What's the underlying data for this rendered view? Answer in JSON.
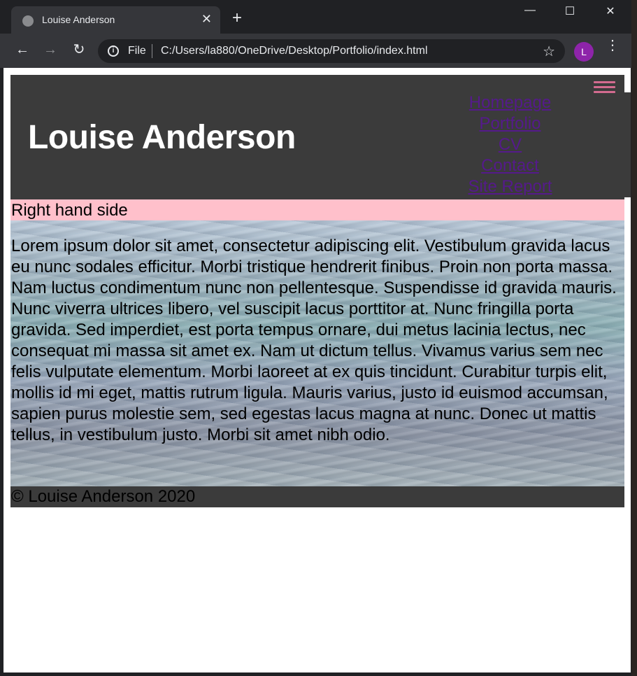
{
  "browser": {
    "tab_title": "Louise Anderson",
    "tab_close": "✕",
    "new_tab": "+",
    "minimize": "—",
    "maximize": "☐",
    "close": "✕",
    "back": "←",
    "forward": "→",
    "reload": "↻",
    "info": "i",
    "scheme": "File",
    "url": "C:/Users/la880/OneDrive/Desktop/Portfolio/index.html",
    "star": "☆",
    "profile_initial": "L",
    "menu": "⋮"
  },
  "page": {
    "site_title": "Louise Anderson",
    "nav": [
      "Homepage",
      "Portfolio",
      "CV",
      "Contact",
      "Site Report"
    ],
    "banner": "Right hand side",
    "body_text": "Lorem ipsum dolor sit amet, consectetur adipiscing elit. Vestibulum gravida lacus eu nunc sodales efficitur. Morbi tristique hendrerit finibus. Proin non porta massa. Nam luctus condimentum nunc non pellentesque. Suspendisse id gravida mauris. Nunc viverra ultrices libero, vel suscipit lacus porttitor at. Nunc fringilla porta gravida. Sed imperdiet, est porta tempus ornare, dui metus lacinia lectus, nec consequat mi massa sit amet ex. Nam ut dictum tellus. Vivamus varius sem nec felis vulputate elementum. Morbi laoreet at ex quis tincidunt. Curabitur turpis elit, mollis id mi eget, mattis rutrum ligula. Mauris varius, justo id euismod accumsan, sapien purus molestie sem, sed egestas lacus magna at nunc. Donec ut mattis tellus, in vestibulum justo. Morbi sit amet nibh odio.",
    "footer": "© Louise Anderson 2020"
  },
  "colors": {
    "header_bg": "#3b3b3b",
    "banner_bg": "#ffc0cb",
    "nav_link": "#551a8b",
    "hamburger": "#d36b8f",
    "profile": "#8e24aa"
  },
  "icons": [
    "globe-icon",
    "close-icon",
    "plus-icon",
    "back-arrow-icon",
    "forward-arrow-icon",
    "reload-icon",
    "info-icon",
    "star-icon",
    "more-vert-icon",
    "hamburger-icon"
  ]
}
